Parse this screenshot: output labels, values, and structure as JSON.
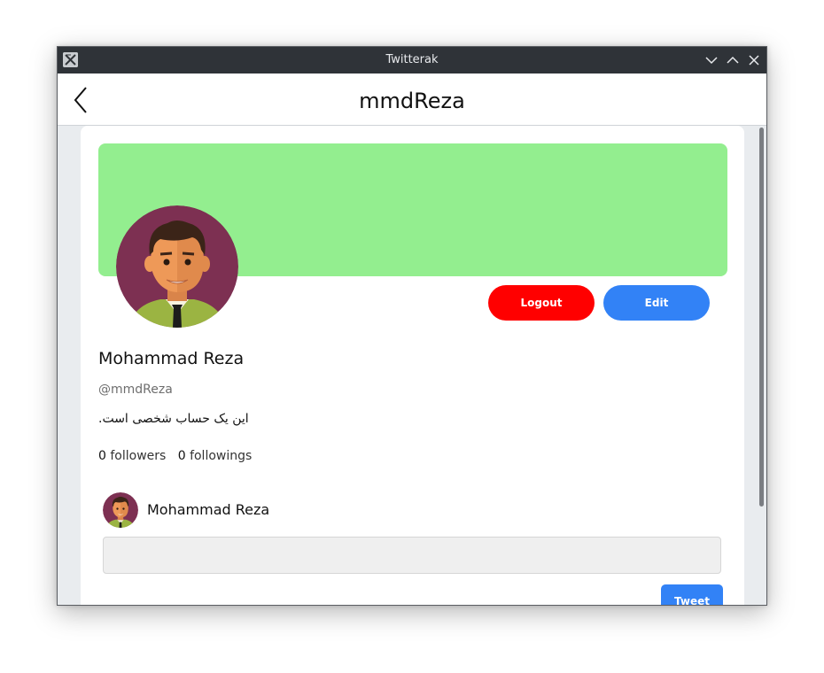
{
  "window": {
    "title": "Twitterak"
  },
  "header": {
    "title": "mmdReza"
  },
  "profile": {
    "name": "Mohammad Reza",
    "handle": "@mmdReza",
    "bio": "این یک حساب شخصی است.",
    "followers_count": "0",
    "followers_label": "followers",
    "followings_count": "0",
    "followings_label": "followings",
    "banner_color": "#93ee8f",
    "avatar_icon": "man-avatar"
  },
  "actions": {
    "logout_label": "Logout",
    "edit_label": "Edit",
    "logout_color": "#ff0000",
    "edit_color": "#3282f6"
  },
  "composer": {
    "author_name": "Mohammad Reza",
    "input_value": "",
    "input_placeholder": "",
    "tweet_label": "Tweet"
  },
  "icons": {
    "back": "chevron-left-icon",
    "minimize": "chevron-down-icon",
    "maximize": "chevron-up-icon",
    "close": "close-icon"
  }
}
